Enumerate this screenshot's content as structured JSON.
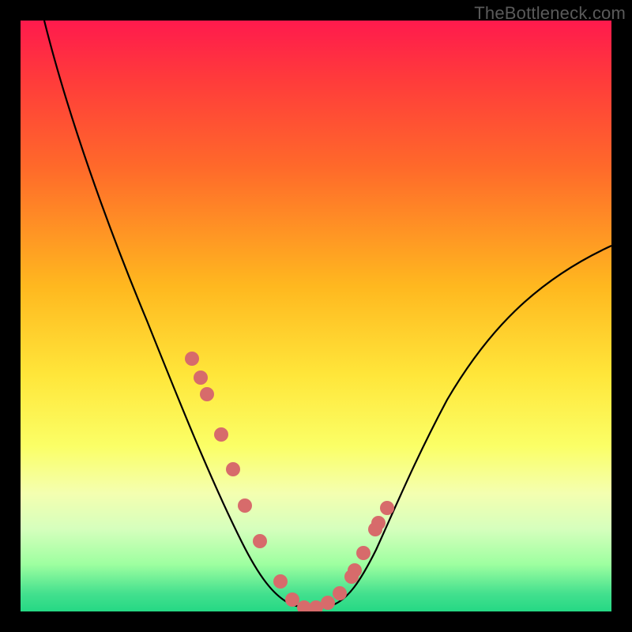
{
  "watermark": "TheBottleneck.com",
  "colors": {
    "frame": "#000000",
    "marker": "#d76b6b",
    "curve": "#000000",
    "gradient_top": "#ff1a4d",
    "gradient_bottom": "#25d884"
  },
  "chart_data": {
    "type": "line",
    "title": "",
    "xlabel": "",
    "ylabel": "",
    "xlim": [
      0,
      100
    ],
    "ylim": [
      0,
      100
    ],
    "x": [
      4,
      8,
      12,
      16,
      20,
      24,
      28,
      30,
      32,
      34,
      36,
      38,
      40,
      42,
      44,
      46,
      47,
      48,
      50,
      52,
      54,
      56,
      58,
      60,
      64,
      68,
      72,
      76,
      80,
      84,
      88,
      92,
      96,
      100
    ],
    "y": [
      100,
      92,
      82,
      73,
      64,
      55,
      46,
      41,
      36,
      30,
      24,
      18,
      12,
      8,
      5,
      2,
      1.5,
      1,
      1,
      1.5,
      3,
      6,
      10,
      14,
      21,
      28,
      34,
      40,
      45,
      49,
      53,
      56,
      59,
      62
    ],
    "markers": {
      "x": [
        29.0,
        30.5,
        31.5,
        34.0,
        36.0,
        38.0,
        40.5,
        44.0,
        46.0,
        48.0,
        50.0,
        52.0,
        54.0,
        56.0,
        56.5,
        58.0,
        60.0,
        60.5,
        62.0
      ],
      "y": [
        43,
        40,
        37,
        30,
        24,
        18,
        12,
        5,
        2,
        1,
        1,
        1.5,
        3,
        6,
        7,
        10,
        14,
        15,
        17.5
      ]
    },
    "note": "Values are approximate, read from pixel positions; chart has no axis ticks or labels."
  }
}
